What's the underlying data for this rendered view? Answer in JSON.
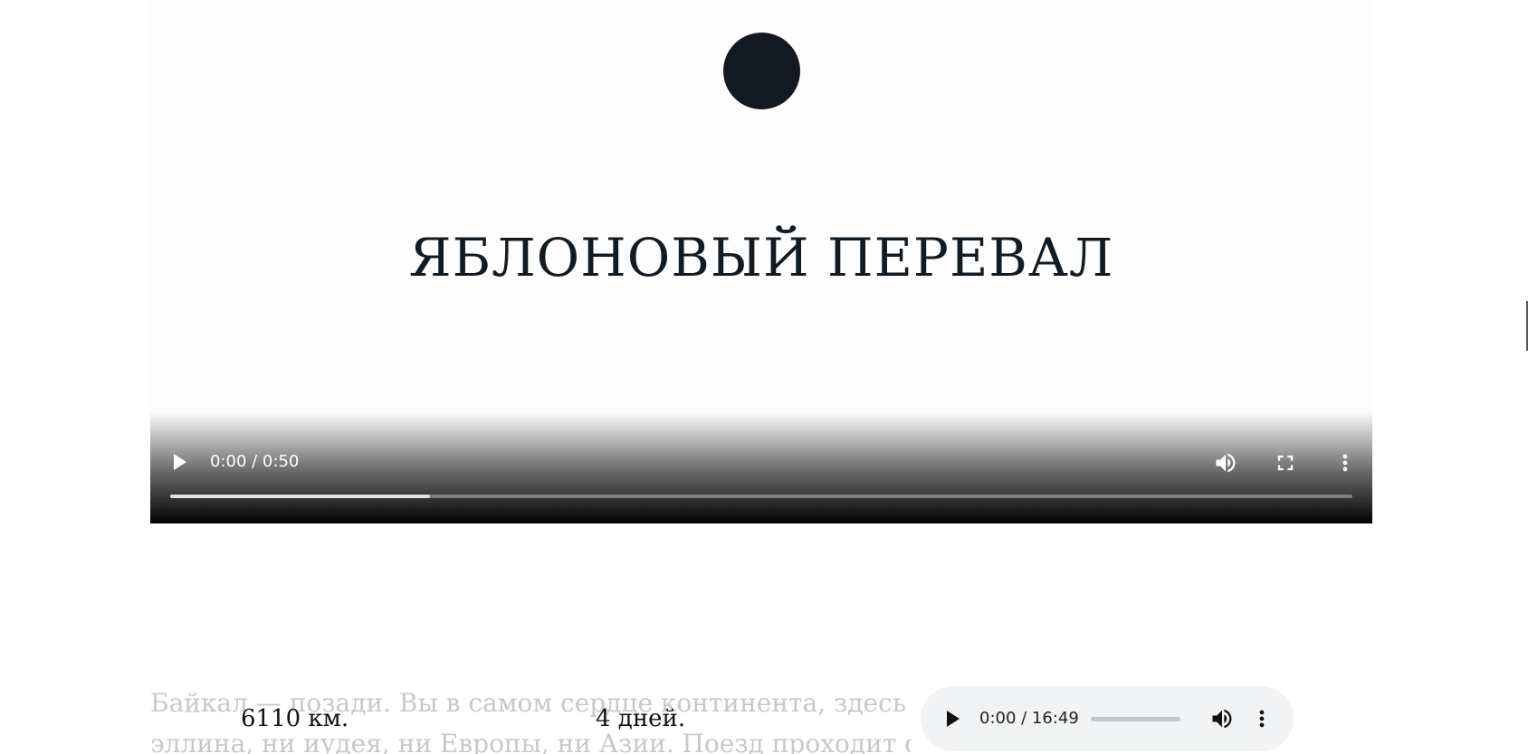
{
  "hero": {
    "title": "ЯБЛОНОВЫЙ ПЕРЕВАЛ"
  },
  "video_player": {
    "time": "0:00 / 0:50",
    "progress_fraction": 0.22,
    "icons": [
      "play-icon",
      "volume-icon",
      "fullscreen-icon",
      "more-options-icon"
    ]
  },
  "article": {
    "line1": "Байкал — позади. Вы в самом сердце континента, здесь нет ни",
    "line2": "эллина, ни иудея, ни Европы, ни Азии. Поезд проходит самую"
  },
  "stats": {
    "distance": "6110 км.",
    "duration": "4 дней."
  },
  "audio_player": {
    "time": "0:00 / 16:49",
    "icons": [
      "play-icon",
      "volume-icon",
      "more-options-icon"
    ]
  },
  "colors": {
    "title": "#131b22",
    "logo": "#111a20",
    "faded_text": "#c8c8c8",
    "audio_bg": "#f1f3f4"
  }
}
